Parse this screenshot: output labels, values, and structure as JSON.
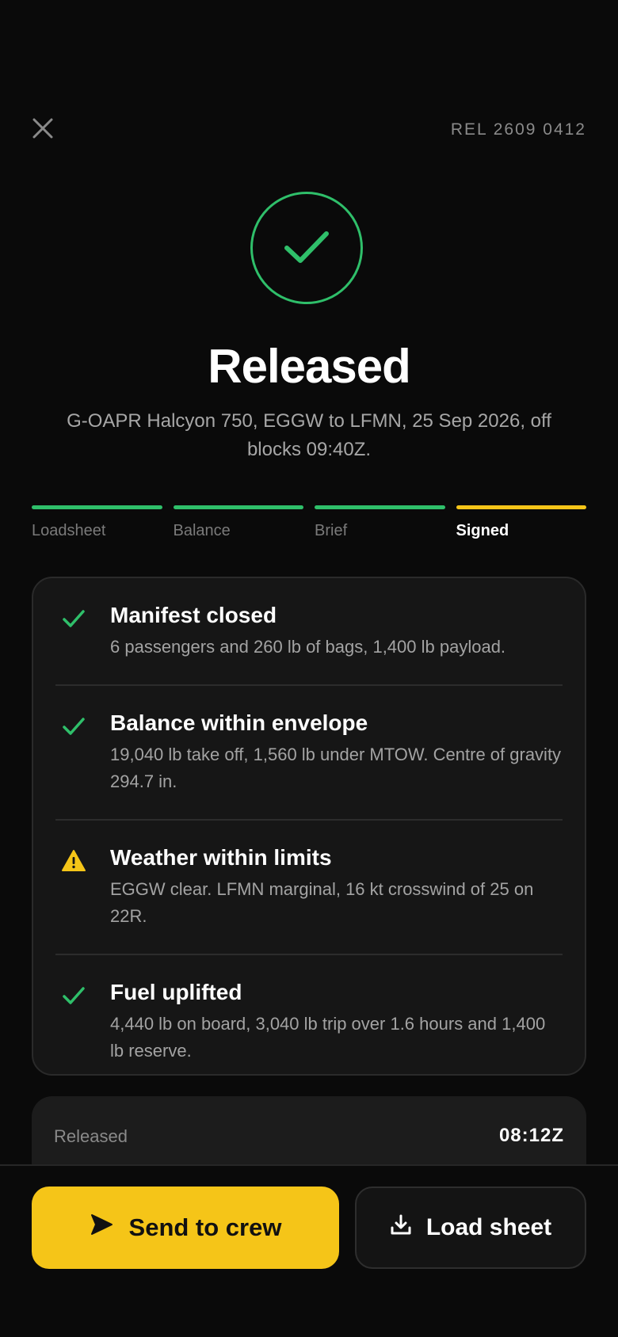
{
  "header": {
    "close_icon": "close-icon",
    "reference": "REL 2609 0412"
  },
  "status": {
    "icon": "check-circle-icon",
    "title": "Released",
    "subtitle": "G-OAPR Halcyon 750, EGGW to LFMN, 25 Sep 2026, off blocks 09:40Z.",
    "accent_color": "#2fbf6a"
  },
  "steps": [
    {
      "label": "Loadsheet",
      "state": "complete"
    },
    {
      "label": "Balance",
      "state": "complete"
    },
    {
      "label": "Brief",
      "state": "complete"
    },
    {
      "label": "Signed",
      "state": "current"
    }
  ],
  "checklist": [
    {
      "status": "ok",
      "icon": "check-icon",
      "heading": "Manifest closed",
      "description": "6 passengers and 260 lb of bags, 1,400 lb payload."
    },
    {
      "status": "ok",
      "icon": "check-icon",
      "heading": "Balance within envelope",
      "description": "19,040 lb take off, 1,560 lb under MTOW. Centre of gravity 294.7 in."
    },
    {
      "status": "warning",
      "icon": "warning-icon",
      "heading": "Weather within limits",
      "description": "EGGW clear. LFMN marginal, 16 kt crosswind of 25 on 22R."
    },
    {
      "status": "ok",
      "icon": "check-icon",
      "heading": "Fuel uplifted",
      "description": "4,440 lb on board, 3,040 lb trip over 1.6 hours and 1,400 lb reserve."
    }
  ],
  "summary": {
    "label": "Released",
    "value": "08:12Z"
  },
  "actions": {
    "primary_label": "Send to crew",
    "primary_icon": "send-icon",
    "secondary_label": "Load sheet",
    "secondary_icon": "download-icon"
  },
  "colors": {
    "success": "#2fbf6a",
    "warning": "#f5c518",
    "background": "#0a0a0a"
  }
}
